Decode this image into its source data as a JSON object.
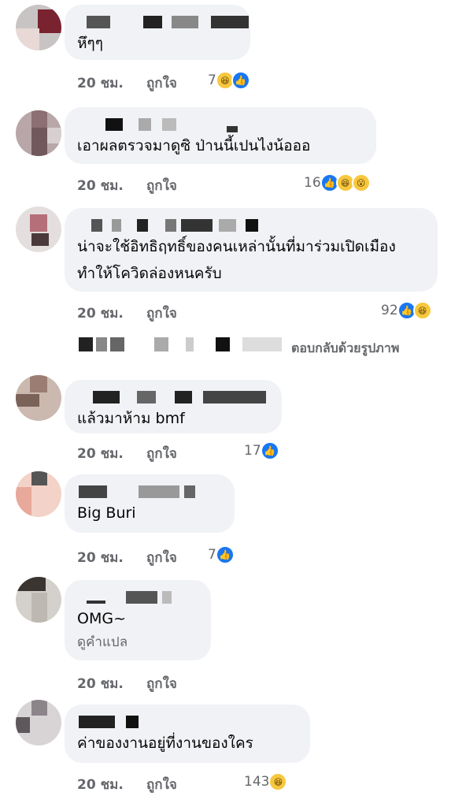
{
  "comments": [
    {
      "text": "หึๆๆ",
      "time": "20 ชม.",
      "like": "ถูกใจ",
      "reactions": "7"
    },
    {
      "text": "เอาผลตรวจมาดูซิ ป่านนี้เปนไงน้อออ",
      "time": "20 ชม.",
      "like": "ถูกใจ",
      "reactions": "16"
    },
    {
      "text": "น่าจะใช้อิทธิฤทธิ์ของคนเหล่านั้นที่มาร่วมเปิดเมือง ทำให้โควิดล่องหนครับ",
      "time": "20 ชม.",
      "like": "ถูกใจ",
      "reactions": "92"
    },
    {
      "text": "แล้วมาห้าม bmf",
      "time": "20 ชม.",
      "like": "ถูกใจ",
      "reactions": "17"
    },
    {
      "text": "Big Buri",
      "time": "20 ชม.",
      "like": "ถูกใจ",
      "reactions": "7"
    },
    {
      "text": "OMG~",
      "translate": "ดูคำแปล",
      "time": "20 ชม.",
      "like": "ถูกใจ"
    },
    {
      "text": "ค่าของงานอยู่ที่งานของใคร",
      "time": "20 ชม.",
      "like": "ถูกใจ",
      "reactions": "143"
    }
  ],
  "reply_prompt": "ตอบกลับด้วยรูปภาพ",
  "colors": {
    "bubble": "#f0f2f5",
    "meta": "#65676b",
    "like_blue": "#1877f2",
    "haha_yellow": "#f7c83e"
  },
  "icons": [
    "like-reaction-icon",
    "haha-reaction-icon",
    "wow-reaction-icon"
  ]
}
